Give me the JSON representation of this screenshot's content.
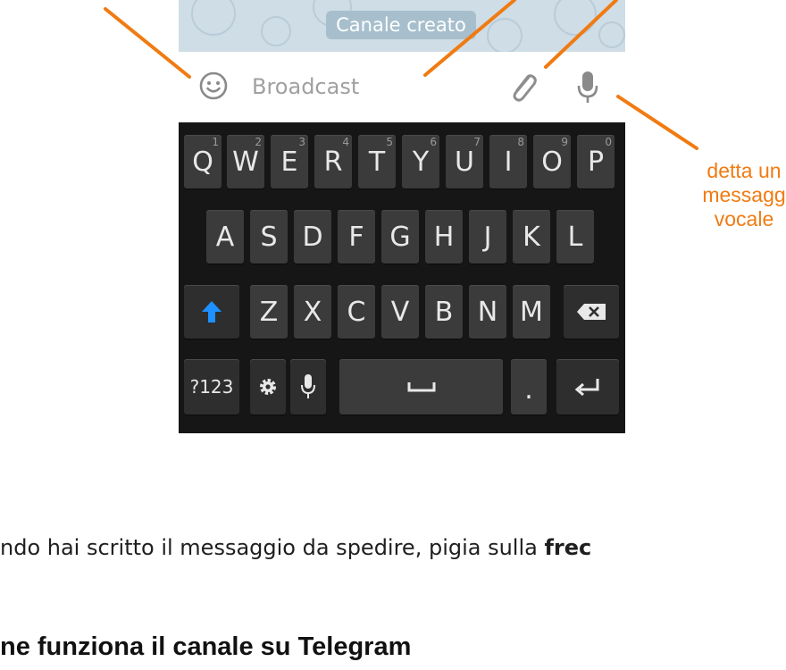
{
  "chat": {
    "service_message": "Canale creato"
  },
  "input_bar": {
    "placeholder": "Broadcast",
    "icons": [
      "emoji-icon",
      "paperclip-icon",
      "microphone-icon"
    ]
  },
  "keyboard": {
    "rows": [
      [
        {
          "label": "Q",
          "hint": "1"
        },
        {
          "label": "W",
          "hint": "2"
        },
        {
          "label": "E",
          "hint": "3"
        },
        {
          "label": "R",
          "hint": "4"
        },
        {
          "label": "T",
          "hint": "5"
        },
        {
          "label": "Y",
          "hint": "6"
        },
        {
          "label": "U",
          "hint": "7"
        },
        {
          "label": "I",
          "hint": "8"
        },
        {
          "label": "O",
          "hint": "9"
        },
        {
          "label": "P",
          "hint": "0"
        }
      ],
      [
        {
          "label": "A"
        },
        {
          "label": "S"
        },
        {
          "label": "D"
        },
        {
          "label": "F"
        },
        {
          "label": "G"
        },
        {
          "label": "H"
        },
        {
          "label": "J"
        },
        {
          "label": "K"
        },
        {
          "label": "L"
        }
      ],
      [
        {
          "label": "Z"
        },
        {
          "label": "X"
        },
        {
          "label": "C"
        },
        {
          "label": "V"
        },
        {
          "label": "B"
        },
        {
          "label": "N"
        },
        {
          "label": "M"
        }
      ]
    ],
    "symbols_key": "?123",
    "period_key": ".",
    "shift_color": "#1e90ff"
  },
  "annotations": {
    "mic_callout": [
      "detta un",
      "messagg",
      "vocale"
    ],
    "accent_color": "#f07b12"
  },
  "article": {
    "paragraph_before": "ndo hai scritto il messaggio da spedire, pigia sulla ",
    "paragraph_bold": "frec",
    "heading": "ne funziona il canale su Telegram"
  }
}
